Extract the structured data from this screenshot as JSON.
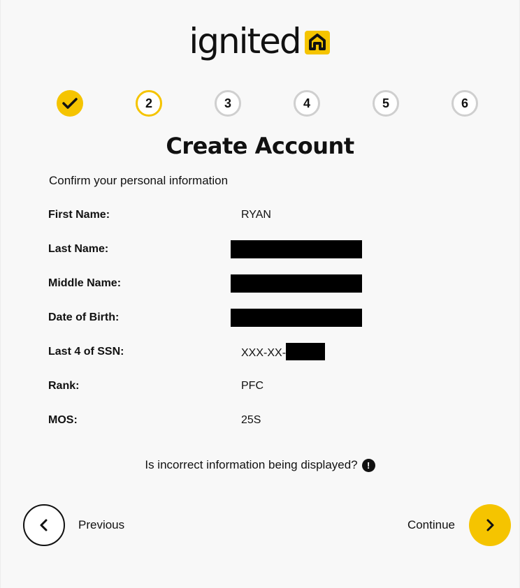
{
  "brand": {
    "logo_text": "ignited",
    "accent_color": "#f5c400"
  },
  "stepper": {
    "steps": [
      {
        "label": "",
        "state": "done",
        "icon": "check-icon"
      },
      {
        "label": "2",
        "state": "current"
      },
      {
        "label": "3",
        "state": "todo"
      },
      {
        "label": "4",
        "state": "todo"
      },
      {
        "label": "5",
        "state": "todo"
      },
      {
        "label": "6",
        "state": "todo"
      }
    ]
  },
  "page": {
    "title": "Create Account",
    "subtitle": "Confirm your personal information"
  },
  "fields": {
    "first_name": {
      "label": "First Name:",
      "value": "RYAN"
    },
    "last_name": {
      "label": "Last Name:",
      "value": ""
    },
    "middle_name": {
      "label": "Middle Name:",
      "value": ""
    },
    "dob": {
      "label": "Date of Birth:",
      "value": ""
    },
    "ssn": {
      "label": "Last 4 of SSN:",
      "value_prefix": "XXX-XX-"
    },
    "rank": {
      "label": "Rank:",
      "value": "PFC"
    },
    "mos": {
      "label": "MOS:",
      "value": "25S"
    }
  },
  "incorrect_info": {
    "text": "Is incorrect information being displayed?",
    "icon": "exclamation-icon"
  },
  "nav": {
    "previous_label": "Previous",
    "continue_label": "Continue",
    "previous_icon": "chevron-left-icon",
    "continue_icon": "chevron-right-icon"
  }
}
